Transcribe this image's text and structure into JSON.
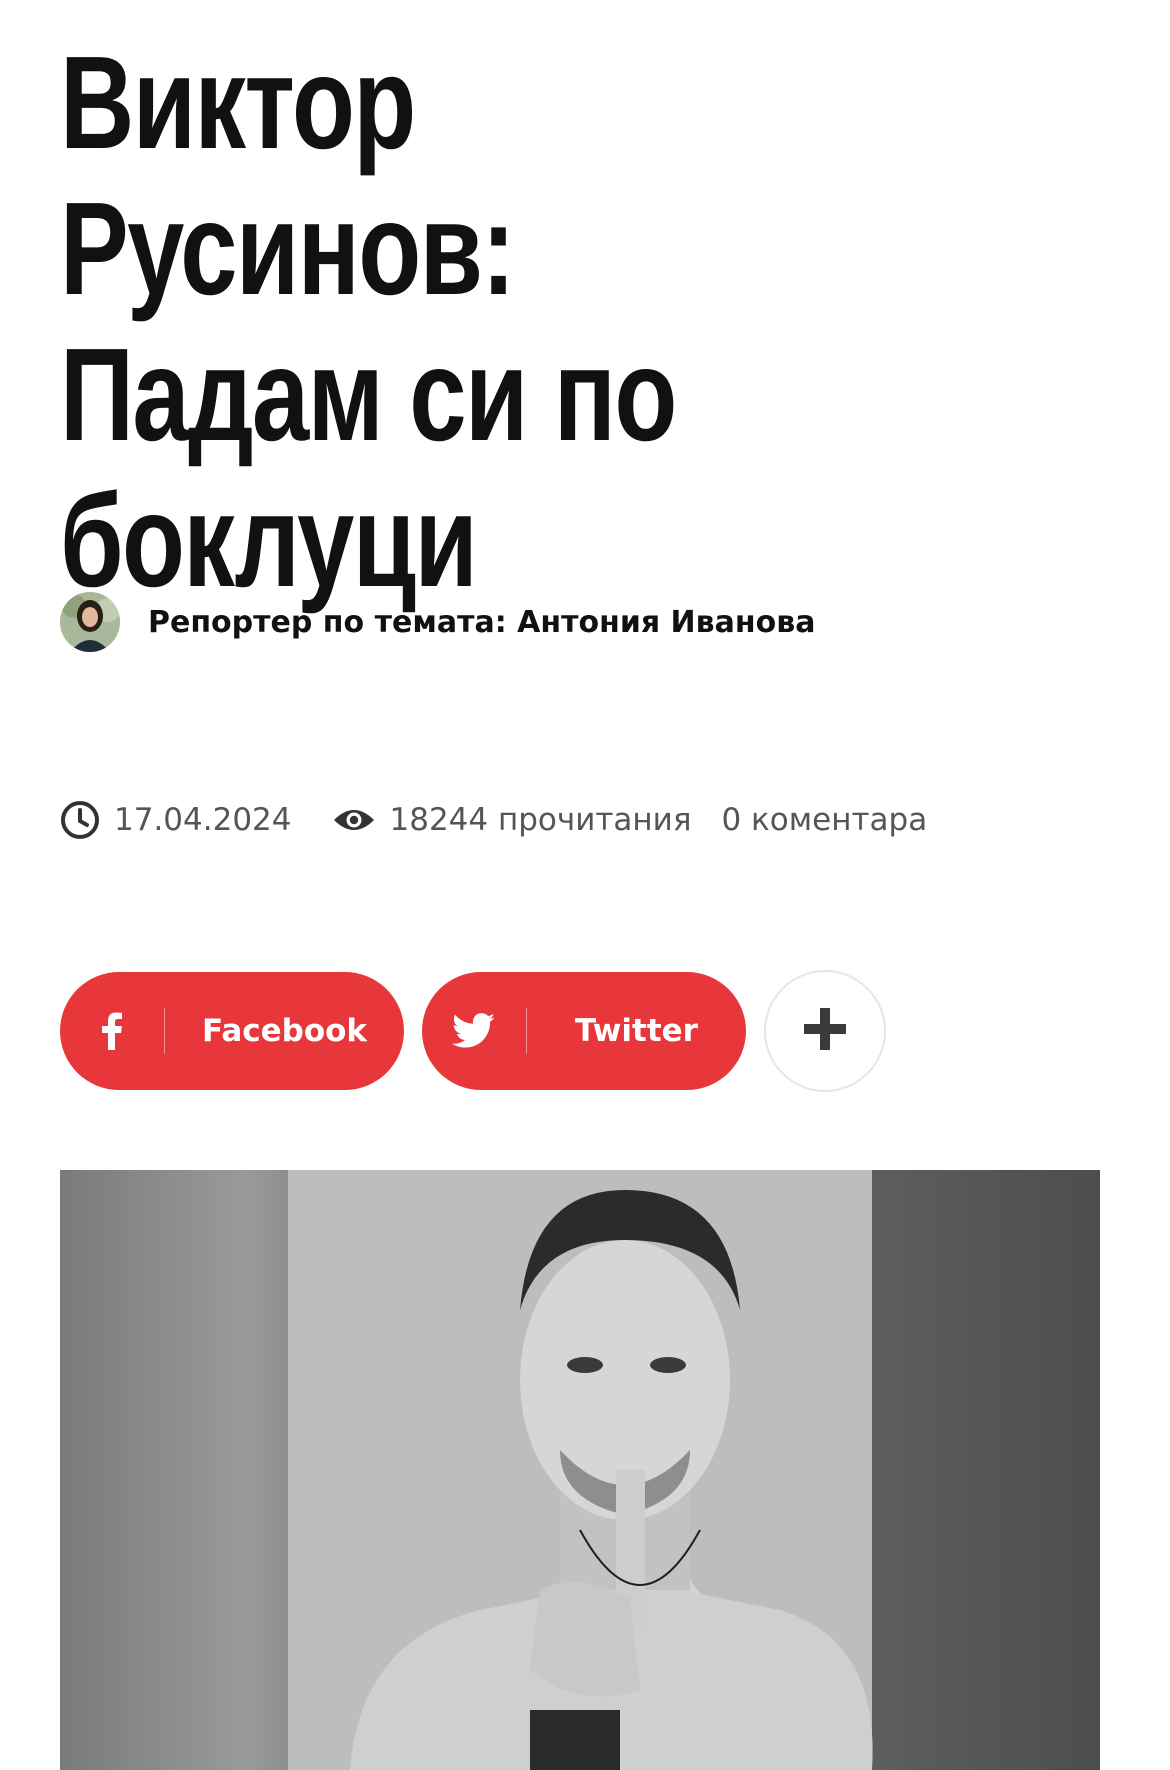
{
  "article": {
    "title": "Виктор Русинов: Падам си по боклуци",
    "author_line": "Репортер по темата: Антония Иванова",
    "date": "17.04.2024",
    "views": "18244 прочитания",
    "comments": "0 коментара"
  },
  "share": {
    "facebook_label": "Facebook",
    "twitter_label": "Twitter",
    "facebook_icon": "facebook-icon",
    "twitter_icon": "twitter-icon",
    "more_icon": "plus-icon",
    "button_color": "#e8373a"
  },
  "icons": {
    "date_icon": "clock-icon",
    "views_icon": "eye-icon"
  }
}
